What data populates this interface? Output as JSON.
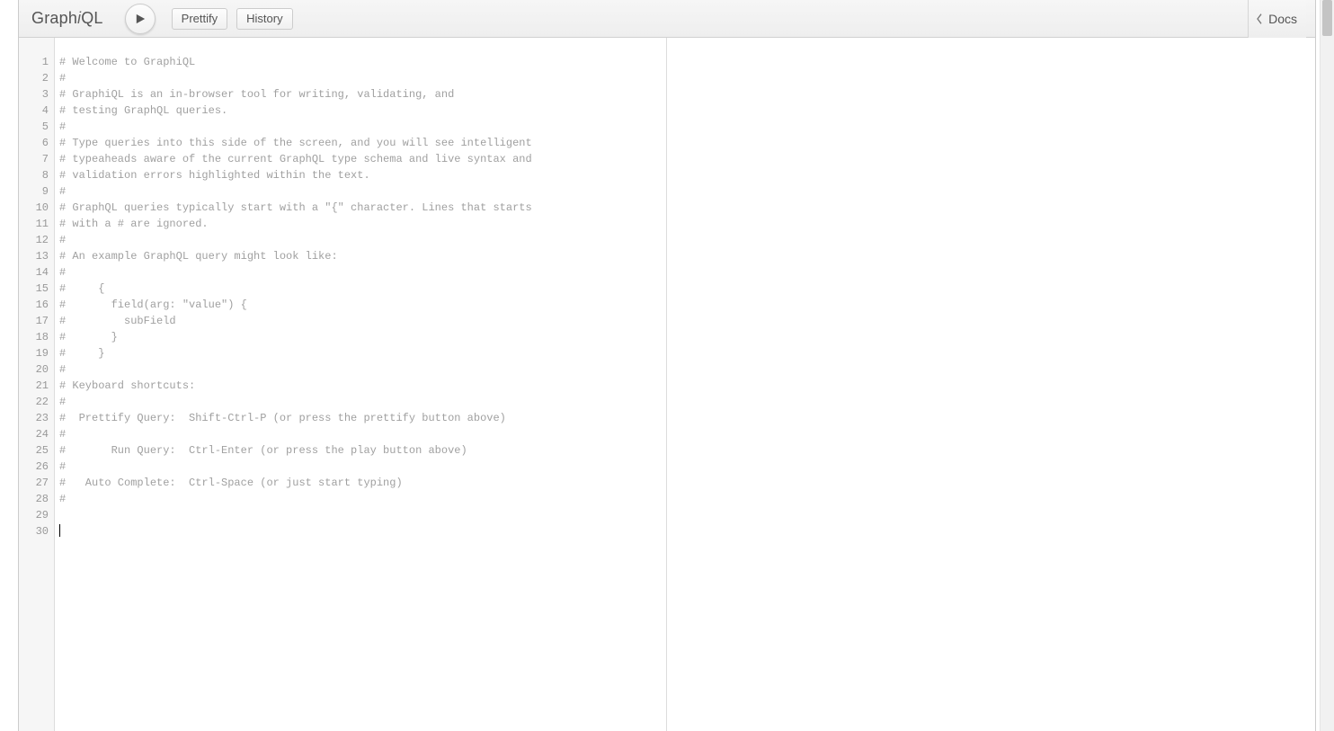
{
  "logo": {
    "pre": "Graph",
    "i": "i",
    "post": "QL"
  },
  "toolbar": {
    "prettify_label": "Prettify",
    "history_label": "History",
    "docs_label": "Docs"
  },
  "editor": {
    "total_lines": 30,
    "cursor_line": 30,
    "lines": [
      "# Welcome to GraphiQL",
      "#",
      "# GraphiQL is an in-browser tool for writing, validating, and",
      "# testing GraphQL queries.",
      "#",
      "# Type queries into this side of the screen, and you will see intelligent",
      "# typeaheads aware of the current GraphQL type schema and live syntax and",
      "# validation errors highlighted within the text.",
      "#",
      "# GraphQL queries typically start with a \"{\" character. Lines that starts",
      "# with a # are ignored.",
      "#",
      "# An example GraphQL query might look like:",
      "#",
      "#     {",
      "#       field(arg: \"value\") {",
      "#         subField",
      "#       }",
      "#     }",
      "#",
      "# Keyboard shortcuts:",
      "#",
      "#  Prettify Query:  Shift-Ctrl-P (or press the prettify button above)",
      "#",
      "#       Run Query:  Ctrl-Enter (or press the play button above)",
      "#",
      "#   Auto Complete:  Ctrl-Space (or just start typing)",
      "#",
      "",
      ""
    ]
  }
}
